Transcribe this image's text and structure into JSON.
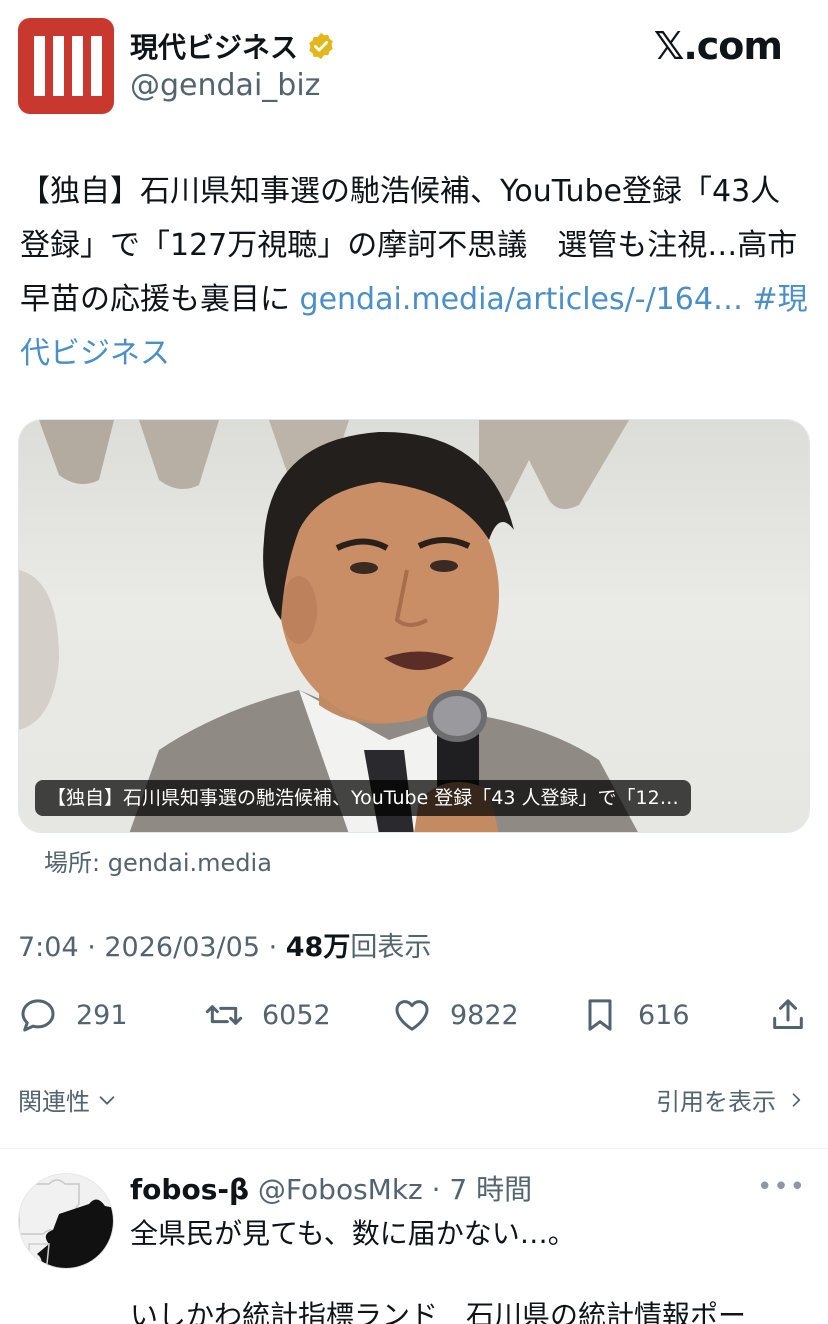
{
  "header": {
    "display_name": "現代ビジネス",
    "handle": "@gendai_biz",
    "site": "𝕏.com"
  },
  "tweet": {
    "text_main": "【独自】石川県知事選の馳浩候補、YouTube登録「43人登録」で「127万視聴」の摩訶不思議　選管も注視…高市早苗の応援も裏目に ",
    "link": "gendai.media/articles/-/164…",
    "hashtag": "#現代ビジネス"
  },
  "card": {
    "caption": "【独自】石川県知事選の馳浩候補、YouTube 登録「43 人登録」で「12…",
    "place": "場所: gendai.media"
  },
  "meta": {
    "time_date": "7:04 · 2026/03/05 · ",
    "views_number": "48万",
    "views_label": "回表示"
  },
  "actions": {
    "replies": "291",
    "reposts": "6052",
    "likes": "9822",
    "bookmarks": "616"
  },
  "links": {
    "related": "関連性",
    "quotes": "引用を表示"
  },
  "reply": {
    "name": "fobos-β",
    "handle_time": " @FobosMkz · 7 時間",
    "text1": "全県民が見ても、数に届かない…。",
    "text2": "いしかわ統計指標ランド　石川県の統計情報ポー"
  },
  "colors": {
    "accent_link": "#4a8fc7",
    "brand_red": "#c8382f",
    "verified_gold": "#e2b719"
  }
}
